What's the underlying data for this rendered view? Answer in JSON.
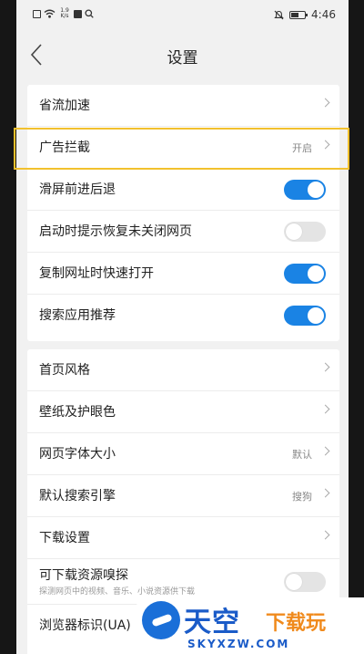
{
  "status_bar": {
    "net_speed_top": "1.9",
    "net_speed_unit": "K/s",
    "time": "4:46"
  },
  "header": {
    "title": "设置"
  },
  "group1": [
    {
      "label": "省流加速",
      "value": "",
      "type": "link"
    },
    {
      "label": "广告拦截",
      "value": "开启",
      "type": "link",
      "highlighted": true
    },
    {
      "label": "滑屏前进后退",
      "type": "toggle",
      "on": true
    },
    {
      "label": "启动时提示恢复未关闭网页",
      "type": "toggle",
      "on": false
    },
    {
      "label": "复制网址时快速打开",
      "type": "toggle",
      "on": true
    },
    {
      "label": "搜索应用推荐",
      "type": "toggle",
      "on": true
    }
  ],
  "group2": [
    {
      "label": "首页风格",
      "value": "",
      "type": "link"
    },
    {
      "label": "壁纸及护眼色",
      "value": "",
      "type": "link"
    },
    {
      "label": "网页字体大小",
      "value": "默认",
      "type": "link"
    },
    {
      "label": "默认搜索引擎",
      "value": "搜狗",
      "type": "link"
    },
    {
      "label": "下载设置",
      "value": "",
      "type": "link"
    },
    {
      "label": "可下载资源嗅探",
      "sub": "探测网页中的视频、音乐、小说资源供下载",
      "type": "toggle",
      "on": false
    },
    {
      "label": "浏览器标识(UA)",
      "type": "link"
    }
  ],
  "watermark": {
    "line1": "天空",
    "line2": "下载玩",
    "line3": "SKYXZW.COM"
  },
  "colors": {
    "accent": "#1a83e4",
    "highlight": "#f2c12e",
    "background": "#f1f1f1"
  }
}
